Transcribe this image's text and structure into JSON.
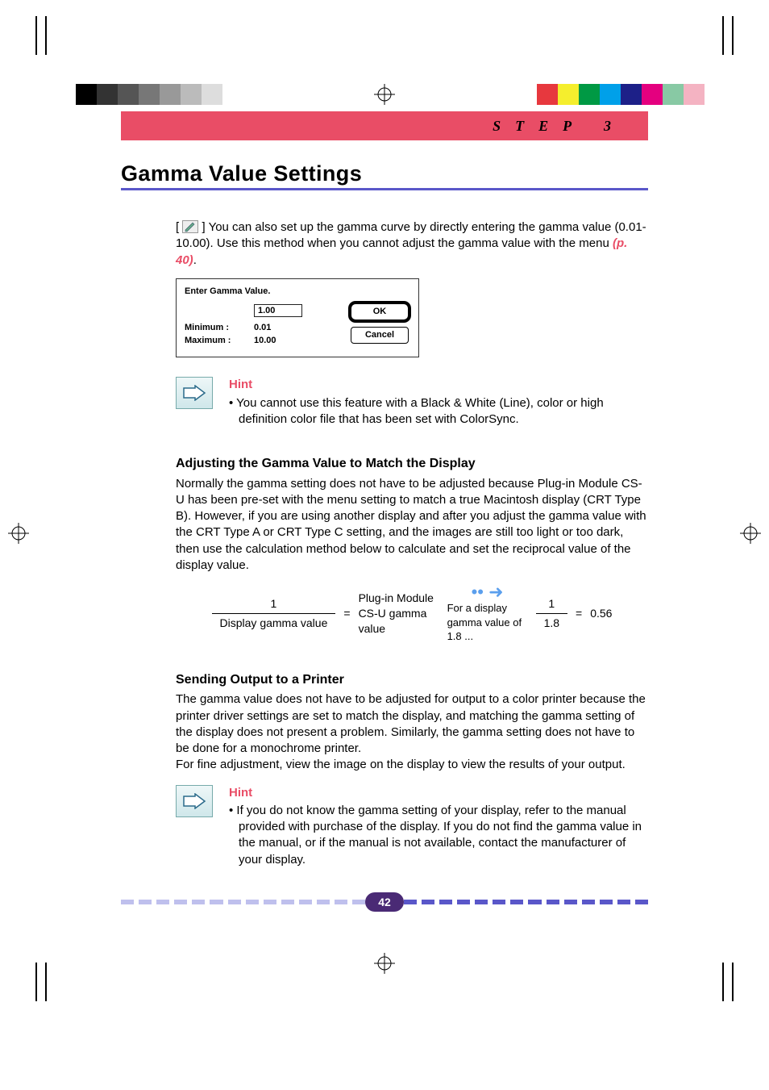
{
  "banner": {
    "step_label": "STEP 3"
  },
  "title": "Gamma Value Settings",
  "intro": {
    "text_a": "[",
    "text_b": "] You can also set up the gamma curve by directly entering the gamma value (0.01-10.00). Use this method when you cannot adjust the gamma value with the menu ",
    "page_ref": "(p. 40)",
    "text_c": "."
  },
  "dialog": {
    "title": "Enter Gamma Value.",
    "value": "1.00",
    "min_label": "Minimum :",
    "min_value": "0.01",
    "max_label": "Maximum :",
    "max_value": "10.00",
    "ok": "OK",
    "cancel": "Cancel"
  },
  "hint1": {
    "heading": "Hint",
    "bullet": "• You cannot use this feature with a Black & White (Line), color or high definition color file that has been set with ColorSync."
  },
  "adjust": {
    "heading": "Adjusting the Gamma Value to Match the Display",
    "body": "Normally the gamma setting does not have to be adjusted because Plug-in Module CS-U has been pre-set with the menu setting to match a true Macintosh display (CRT Type B).  However, if you are using another display and after you adjust the gamma value with the CRT Type A or CRT Type C setting, and the images are still too light or too dark, then use the calculation method below to calculate and set the reciprocal value of the display value."
  },
  "formula": {
    "left_num": "1",
    "left_den": "Display gamma value",
    "eq1": "=",
    "mid": "Plug-in Module CS-U gamma value",
    "arrow_caption": "For a display gamma value of 1.8 ...",
    "right_num": "1",
    "right_den": "1.8",
    "eq2": "=",
    "result": "0.56"
  },
  "printer": {
    "heading": "Sending Output to a Printer",
    "body1": "The gamma value does not have to be adjusted for output to a color printer because the printer driver settings are set to match the display, and matching the gamma setting of the display does not present a problem.  Similarly, the gamma setting does not have to be done for a monochrome printer.",
    "body2": "For fine adjustment, view the image on the display to view the results of your output."
  },
  "hint2": {
    "heading": "Hint",
    "bullet": "• If you do not know the gamma setting of your display, refer to the manual provided with purchase of the display.  If you do not find the gamma value in the manual, or if the manual is not available, contact the manufacturer of your display."
  },
  "page_number": "42",
  "swatch_left": [
    "#000",
    "#333",
    "#555",
    "#777",
    "#999",
    "#bbb",
    "#ddd",
    "#fff"
  ],
  "swatch_right": [
    "#e7383e",
    "#f5ee2d",
    "#009944",
    "#00a0e9",
    "#1d2088",
    "#e4007f",
    "#88c9a4",
    "#f4b3c2"
  ]
}
